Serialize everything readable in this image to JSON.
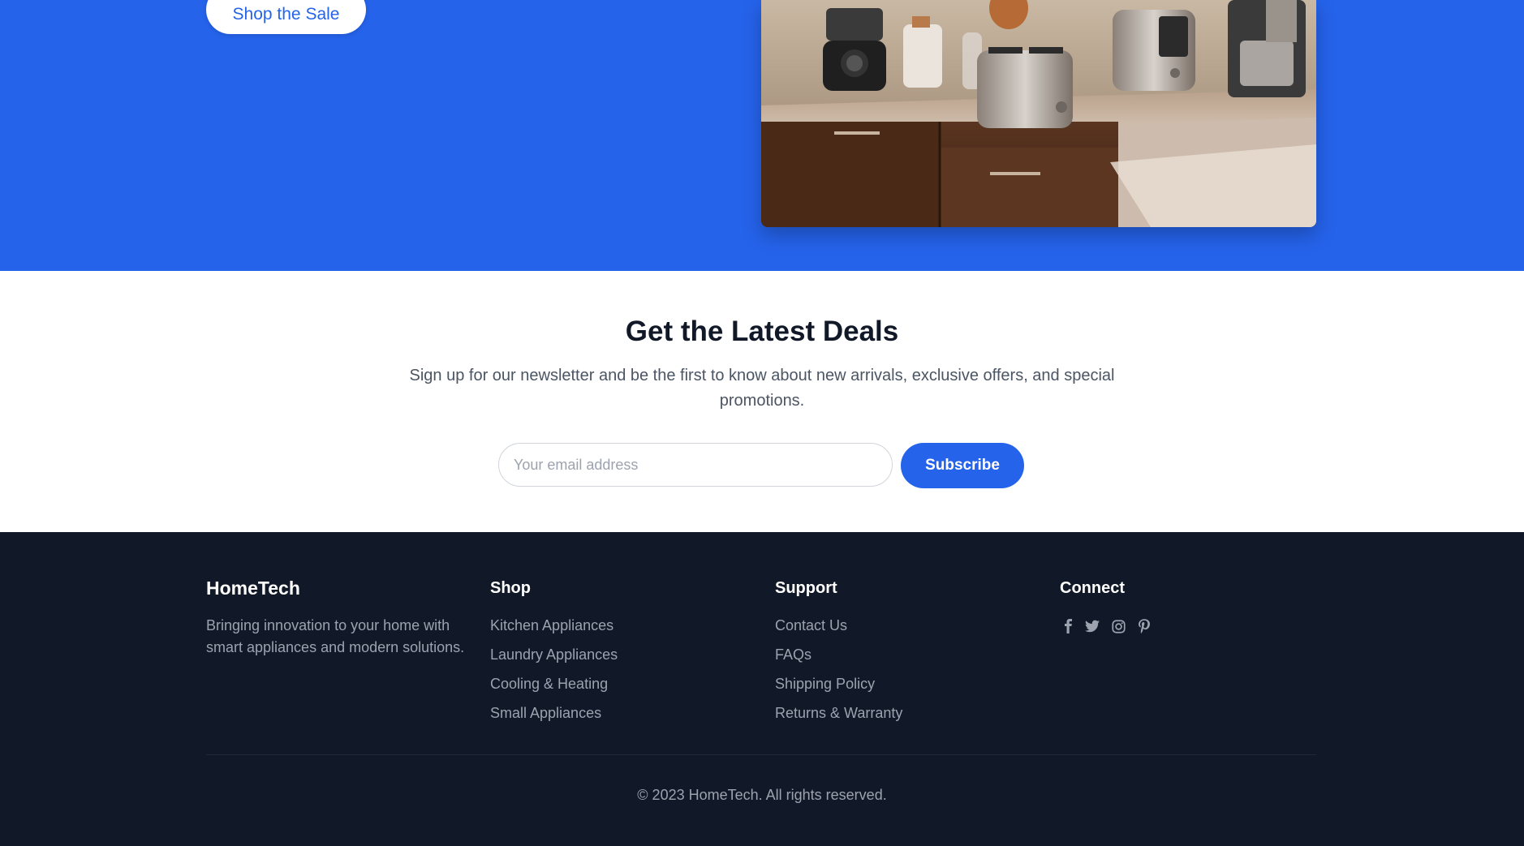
{
  "hero": {
    "cta_label": "Shop the Sale",
    "image_alt": "kitchen-appliances-photo"
  },
  "newsletter": {
    "title": "Get the Latest Deals",
    "description": "Sign up for our newsletter and be the first to know about new arrivals, exclusive offers, and special promotions.",
    "email_placeholder": "Your email address",
    "email_value": "",
    "subscribe_label": "Subscribe"
  },
  "footer": {
    "brand": {
      "name": "HomeTech",
      "tagline": "Bringing innovation to your home with smart appliances and modern solutions."
    },
    "shop": {
      "title": "Shop",
      "links": [
        "Kitchen Appliances",
        "Laundry Appliances",
        "Cooling & Heating",
        "Small Appliances"
      ]
    },
    "support": {
      "title": "Support",
      "links": [
        "Contact Us",
        "FAQs",
        "Shipping Policy",
        "Returns & Warranty"
      ]
    },
    "connect": {
      "title": "Connect",
      "icons": [
        "facebook-icon",
        "twitter-icon",
        "instagram-icon",
        "pinterest-icon"
      ]
    },
    "copyright": "© 2023 HomeTech. All rights reserved."
  },
  "colors": {
    "primary": "#2563eb",
    "footer_bg": "#111827",
    "muted_text": "#9ca3af"
  }
}
